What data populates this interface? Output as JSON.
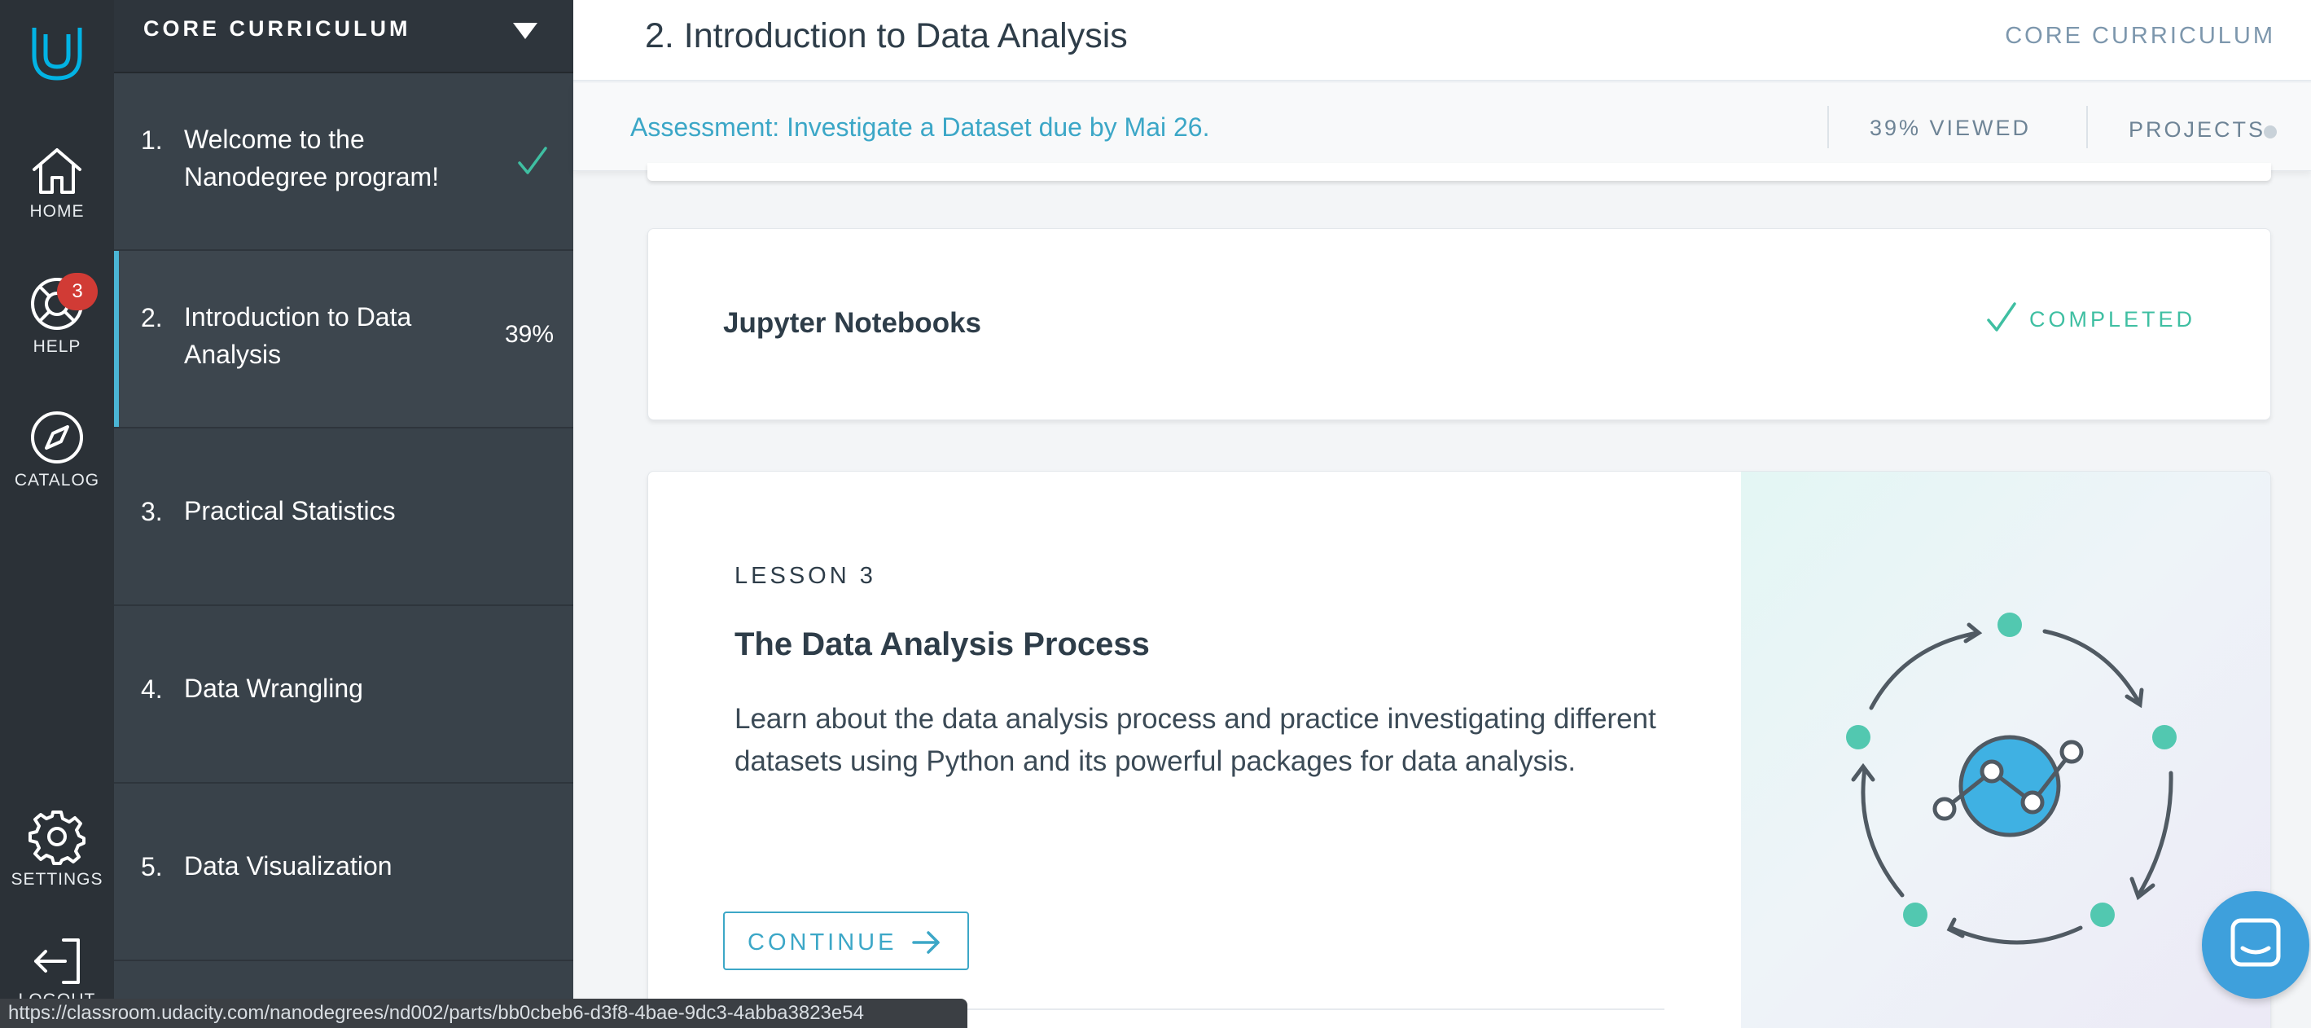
{
  "rail": {
    "home_label": "HOME",
    "help_label": "HELP",
    "help_badge": "3",
    "catalog_label": "CATALOG",
    "settings_label": "SETTINGS",
    "logout_label": "LOGOUT"
  },
  "panel": {
    "title": "CORE CURRICULUM",
    "lessons": [
      {
        "num": "1.",
        "name": "Welcome to the Nanodegree program!",
        "status": "completed"
      },
      {
        "num": "2.",
        "name": "Introduction to Data Analysis",
        "progress": "39%"
      },
      {
        "num": "3.",
        "name": "Practical Statistics"
      },
      {
        "num": "4.",
        "name": "Data Wrangling"
      },
      {
        "num": "5.",
        "name": "Data Visualization"
      }
    ]
  },
  "header": {
    "page_title": "2. Introduction to Data Analysis",
    "section_link": "CORE CURRICULUM"
  },
  "assessment": {
    "text": "Assessment: Investigate a Dataset due by Mai 26.",
    "viewed": "39% VIEWED",
    "projects": "PROJECTS"
  },
  "notebook_card": {
    "title": "Jupyter Notebooks",
    "status": "COMPLETED"
  },
  "lesson_card": {
    "kicker": "LESSON 3",
    "title": "The Data Analysis Process",
    "description": "Learn about the data analysis process and practice investigating different datasets using Python and its powerful packages for data analysis.",
    "button_label": "CONTINUE"
  },
  "status_bar": {
    "url": "https://classroom.udacity.com/nanodegrees/nd002/parts/bb0cbeb6-d3f8-4bae-9dc3-4abba3823e54"
  },
  "colors": {
    "accent": "#3ca7c7",
    "completed": "#3fbfa2",
    "badge": "#d13b35",
    "sidebar": "#39424a",
    "rail": "#2b3137"
  }
}
